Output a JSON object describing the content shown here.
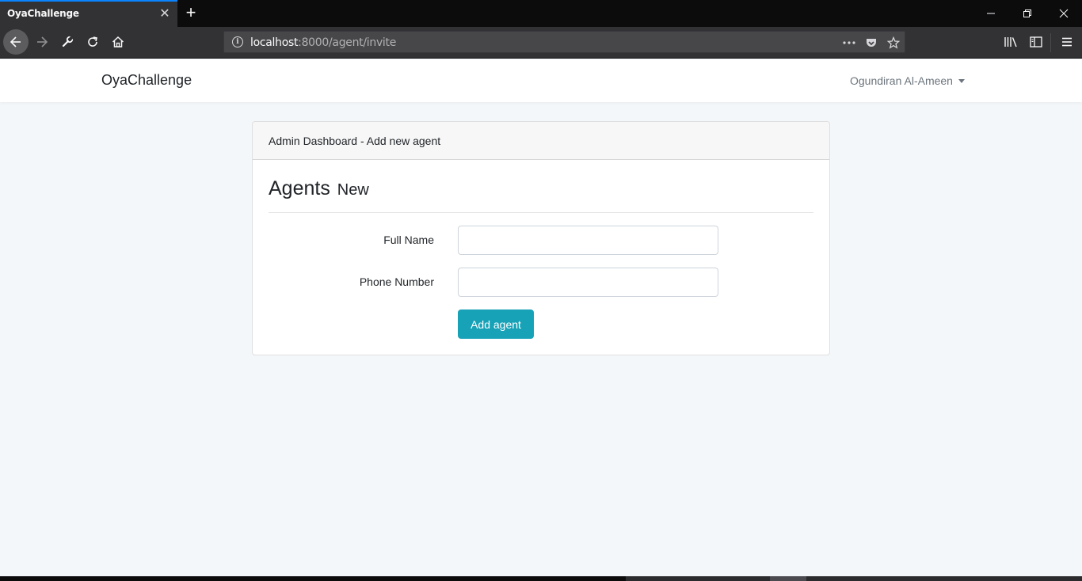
{
  "browser": {
    "tab_title": "OyaChallenge",
    "url_host": "localhost",
    "url_path": ":8000/agent/invite"
  },
  "site": {
    "brand": "OyaChallenge",
    "user_name": "Ogundiran Al-Ameen"
  },
  "card": {
    "header": "Admin Dashboard - Add new agent",
    "title": "Agents",
    "title_small": "New",
    "fields": [
      {
        "label": "Full Name",
        "value": "",
        "placeholder": ""
      },
      {
        "label": "Phone Number",
        "value": "",
        "placeholder": ""
      }
    ],
    "submit_label": "Add agent"
  },
  "colors": {
    "accent": "#17a2b8",
    "tab_highlight": "#0a84ff",
    "page_background": "#f4f7fa"
  }
}
